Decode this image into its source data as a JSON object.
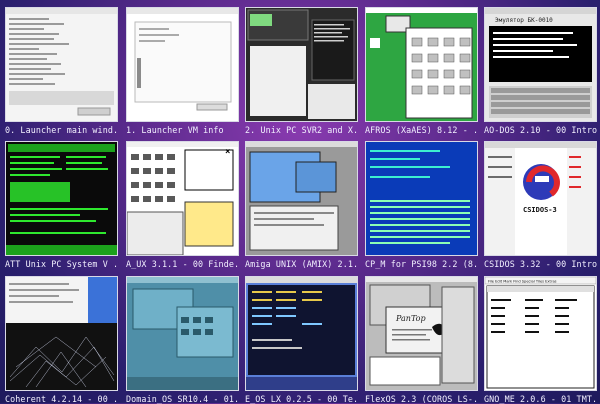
{
  "tiles": [
    {
      "caption": "0. Launcher main wind..."
    },
    {
      "caption": "1. Launcher VM info"
    },
    {
      "caption": "2. Unix PC SVR2 and X..."
    },
    {
      "caption": "AFROS (XaAES) 8.12 - ..."
    },
    {
      "caption": "AO-DOS 2.10 - 00 Intro"
    },
    {
      "caption": "ATT Unix PC System V ..."
    },
    {
      "caption": "A_UX 3.1.1 - 00 Finde..."
    },
    {
      "caption": "Amiga UNIX (AMIX) 2.1..."
    },
    {
      "caption": "CP_M for PSI98 2.2 (8..."
    },
    {
      "caption": "CSIDOS 3.32 - 00 Intro"
    },
    {
      "caption": "Coherent 4.2.14 - 00 ..."
    },
    {
      "caption": "Domain_OS SR10.4 - 01..."
    },
    {
      "caption": "E_OS LX 0.2.5 - 00 Te..."
    },
    {
      "caption": "FlexOS 2.3 (COROS LS-..."
    },
    {
      "caption": "GNO_ME 2.0.6 - 01 TMT..."
    }
  ],
  "screen_text": {
    "emulator_title": "Эмулятор БК-0010",
    "csidos_logo": "CSIDOS-3",
    "pantop": "PanTop",
    "gno_menu": "File Edit Mark Find Special Tiles Extras"
  }
}
